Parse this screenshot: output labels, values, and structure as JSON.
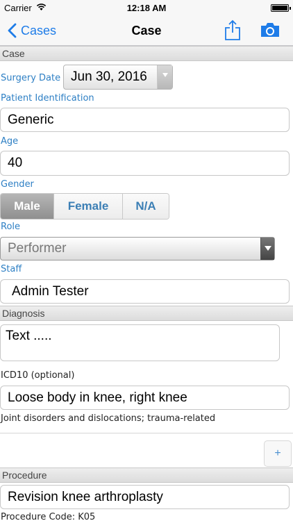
{
  "status_bar": {
    "carrier": "Carrier",
    "time": "12:18 AM"
  },
  "nav": {
    "back_label": "Cases",
    "title": "Case"
  },
  "case_section": {
    "header": "Case",
    "surgery_date_label": "Surgery Date",
    "surgery_date_value": "Jun 30, 2016",
    "patient_id_label": "Patient Identification",
    "patient_id_value": "Generic",
    "age_label": "Age",
    "age_value": "40",
    "gender_label": "Gender",
    "gender_options": [
      "Male",
      "Female",
      "N/A"
    ],
    "gender_selected": "Male",
    "role_label": "Role",
    "role_value": "Performer",
    "staff_label": "Staff",
    "staff_value": "Admin Tester"
  },
  "diagnosis_section": {
    "header": "Diagnosis",
    "text_value": "Text .....",
    "icd10_label": "ICD10 (optional)",
    "icd10_value": "Loose body in knee, right knee",
    "icd10_category": "Joint disorders and dislocations; trauma-related",
    "add_label": "+"
  },
  "procedure_section": {
    "header": "Procedure",
    "procedure_value": "Revision knee arthroplasty",
    "procedure_code": "Procedure Code: K05"
  },
  "colors": {
    "accent": "#1e7ce8",
    "label_blue": "#2d7fc4"
  }
}
